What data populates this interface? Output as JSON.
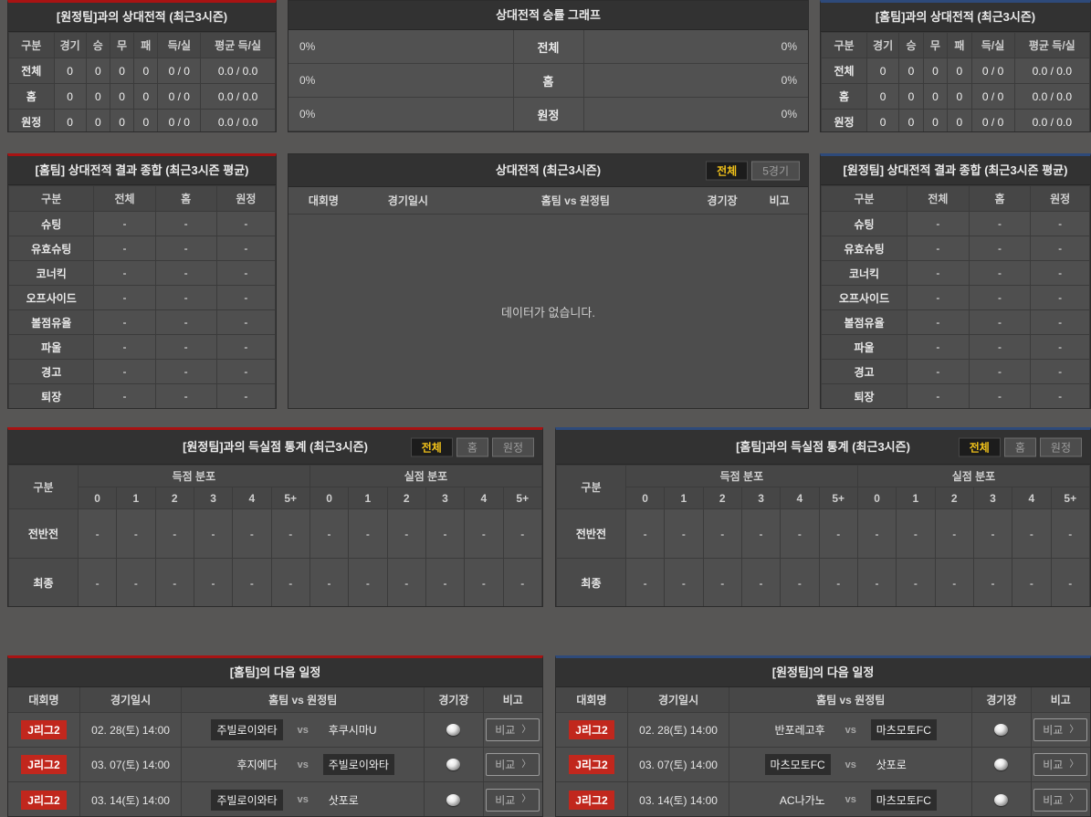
{
  "common": {
    "vs": "vs",
    "compare": "비교",
    "chevron": "〉",
    "gubun": "구분"
  },
  "colors": {
    "home_accent": "#a81313",
    "away_accent": "#2e4a7a",
    "active_tab_text": "#f0c11a",
    "league_badge_bg": "#c1271d",
    "panel_bg": "#4d4d4d",
    "title_bg": "#323232"
  },
  "h2h_away": {
    "title": "[원정팀]과의 상대전적 (최근3시즌)",
    "columns": [
      "구분",
      "경기",
      "승",
      "무",
      "패",
      "득/실",
      "평균 득/실"
    ],
    "rows": [
      {
        "label": "전체",
        "values": [
          "0",
          "0",
          "0",
          "0",
          "0 / 0",
          "0.0 / 0.0"
        ]
      },
      {
        "label": "홈",
        "values": [
          "0",
          "0",
          "0",
          "0",
          "0 / 0",
          "0.0 / 0.0"
        ]
      },
      {
        "label": "원정",
        "values": [
          "0",
          "0",
          "0",
          "0",
          "0 / 0",
          "0.0 / 0.0"
        ]
      }
    ]
  },
  "winrate_graph": {
    "title": "상대전적 승률 그래프",
    "rows": [
      {
        "label": "전체",
        "left_pct": "0%",
        "right_pct": "0%",
        "left_value": 0,
        "right_value": 0
      },
      {
        "label": "홈",
        "left_pct": "0%",
        "right_pct": "0%",
        "left_value": 0,
        "right_value": 0
      },
      {
        "label": "원정",
        "left_pct": "0%",
        "right_pct": "0%",
        "left_value": 0,
        "right_value": 0
      }
    ]
  },
  "h2h_home": {
    "title": "[홈팀]과의 상대전적 (최근3시즌)",
    "columns": [
      "구분",
      "경기",
      "승",
      "무",
      "패",
      "득/실",
      "평균 득/실"
    ],
    "rows": [
      {
        "label": "전체",
        "values": [
          "0",
          "0",
          "0",
          "0",
          "0 / 0",
          "0.0 / 0.0"
        ]
      },
      {
        "label": "홈",
        "values": [
          "0",
          "0",
          "0",
          "0",
          "0 / 0",
          "0.0 / 0.0"
        ]
      },
      {
        "label": "원정",
        "values": [
          "0",
          "0",
          "0",
          "0",
          "0 / 0",
          "0.0 / 0.0"
        ]
      }
    ]
  },
  "summary_home": {
    "title": "[홈팀] 상대전적 결과 종합 (최근3시즌 평균)",
    "columns": [
      "구분",
      "전체",
      "홈",
      "원정"
    ],
    "rows": [
      {
        "label": "슈팅",
        "values": [
          "-",
          "-",
          "-"
        ]
      },
      {
        "label": "유효슈팅",
        "values": [
          "-",
          "-",
          "-"
        ]
      },
      {
        "label": "코너킥",
        "values": [
          "-",
          "-",
          "-"
        ]
      },
      {
        "label": "오프사이드",
        "values": [
          "-",
          "-",
          "-"
        ]
      },
      {
        "label": "볼점유율",
        "values": [
          "-",
          "-",
          "-"
        ]
      },
      {
        "label": "파울",
        "values": [
          "-",
          "-",
          "-"
        ]
      },
      {
        "label": "경고",
        "values": [
          "-",
          "-",
          "-"
        ]
      },
      {
        "label": "퇴장",
        "values": [
          "-",
          "-",
          "-"
        ]
      }
    ]
  },
  "h2h_list": {
    "title": "상대전적 (최근3시즌)",
    "tabs": [
      "전체",
      "5경기"
    ],
    "active_tab": 0,
    "columns": [
      "대회명",
      "경기일시",
      "홈팀 vs 원정팀",
      "경기장",
      "비고"
    ],
    "empty_message": "데이터가 없습니다."
  },
  "summary_away": {
    "title": "[원정팀] 상대전적 결과 종합 (최근3시즌 평균)",
    "columns": [
      "구분",
      "전체",
      "홈",
      "원정"
    ],
    "rows": [
      {
        "label": "슈팅",
        "values": [
          "-",
          "-",
          "-"
        ]
      },
      {
        "label": "유효슈팅",
        "values": [
          "-",
          "-",
          "-"
        ]
      },
      {
        "label": "코너킥",
        "values": [
          "-",
          "-",
          "-"
        ]
      },
      {
        "label": "오프사이드",
        "values": [
          "-",
          "-",
          "-"
        ]
      },
      {
        "label": "볼점유율",
        "values": [
          "-",
          "-",
          "-"
        ]
      },
      {
        "label": "파울",
        "values": [
          "-",
          "-",
          "-"
        ]
      },
      {
        "label": "경고",
        "values": [
          "-",
          "-",
          "-"
        ]
      },
      {
        "label": "퇴장",
        "values": [
          "-",
          "-",
          "-"
        ]
      }
    ]
  },
  "goals_stats_away": {
    "title": "[원정팀]과의 득실점 통계 (최근3시즌)",
    "tabs": [
      "전체",
      "홈",
      "원정"
    ],
    "active_tab": 0,
    "corner_label": "구분",
    "group_headers": [
      "득점 분포",
      "실점 분포"
    ],
    "score_columns": [
      "0",
      "1",
      "2",
      "3",
      "4",
      "5+"
    ],
    "rows": [
      {
        "label": "전반전",
        "scored": [
          "-",
          "-",
          "-",
          "-",
          "-",
          "-"
        ],
        "conceded": [
          "-",
          "-",
          "-",
          "-",
          "-",
          "-"
        ]
      },
      {
        "label": "최종",
        "scored": [
          "-",
          "-",
          "-",
          "-",
          "-",
          "-"
        ],
        "conceded": [
          "-",
          "-",
          "-",
          "-",
          "-",
          "-"
        ]
      }
    ]
  },
  "goals_stats_home": {
    "title": "[홈팀]과의 득실점 통계 (최근3시즌)",
    "tabs": [
      "전체",
      "홈",
      "원정"
    ],
    "active_tab": 0,
    "corner_label": "구분",
    "group_headers": [
      "득점 분포",
      "실점 분포"
    ],
    "score_columns": [
      "0",
      "1",
      "2",
      "3",
      "4",
      "5+"
    ],
    "rows": [
      {
        "label": "전반전",
        "scored": [
          "-",
          "-",
          "-",
          "-",
          "-",
          "-"
        ],
        "conceded": [
          "-",
          "-",
          "-",
          "-",
          "-",
          "-"
        ]
      },
      {
        "label": "최종",
        "scored": [
          "-",
          "-",
          "-",
          "-",
          "-",
          "-"
        ],
        "conceded": [
          "-",
          "-",
          "-",
          "-",
          "-",
          "-"
        ]
      }
    ]
  },
  "schedule_home": {
    "title": "[홈팀]의 다음 일정",
    "columns": [
      "대회명",
      "경기일시",
      "홈팀 vs 원정팀",
      "경기장",
      "비고"
    ],
    "rows": [
      {
        "league": "J리그2",
        "datetime": "02. 28(토) 14:00",
        "home": "주빌로이와타",
        "away": "후쿠시마U",
        "highlight": "home"
      },
      {
        "league": "J리그2",
        "datetime": "03. 07(토) 14:00",
        "home": "후지에다",
        "away": "주빌로이와타",
        "highlight": "away"
      },
      {
        "league": "J리그2",
        "datetime": "03. 14(토) 14:00",
        "home": "주빌로이와타",
        "away": "삿포로",
        "highlight": "home"
      }
    ]
  },
  "schedule_away": {
    "title": "[원정팀]의 다음 일정",
    "columns": [
      "대회명",
      "경기일시",
      "홈팀 vs 원정팀",
      "경기장",
      "비고"
    ],
    "rows": [
      {
        "league": "J리그2",
        "datetime": "02. 28(토) 14:00",
        "home": "반포레고후",
        "away": "마츠모토FC",
        "highlight": "away"
      },
      {
        "league": "J리그2",
        "datetime": "03. 07(토) 14:00",
        "home": "마츠모토FC",
        "away": "삿포로",
        "highlight": "home"
      },
      {
        "league": "J리그2",
        "datetime": "03. 14(토) 14:00",
        "home": "AC나가노",
        "away": "마츠모토FC",
        "highlight": "away"
      }
    ]
  }
}
